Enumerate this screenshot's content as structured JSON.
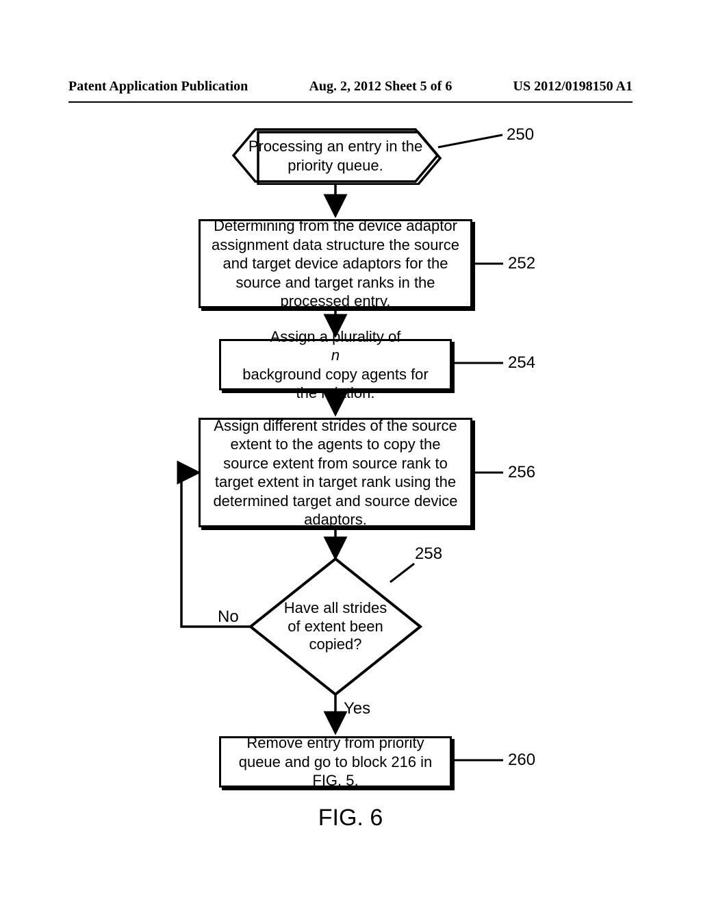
{
  "header": {
    "left": "Patent Application Publication",
    "mid": "Aug. 2, 2012  Sheet 5 of 6",
    "right": "US 2012/0198150 A1"
  },
  "fig": {
    "caption": "FIG. 6"
  },
  "nodes": {
    "n250": {
      "ref": "250",
      "text": "Processing an entry in the priority queue."
    },
    "n252": {
      "ref": "252",
      "text": "Determining from the device adaptor assignment data structure the source and target device adaptors for the source and target ranks in the processed entry."
    },
    "n254": {
      "ref": "254",
      "text_a": "Assign a plurality of ",
      "text_ital": "n",
      "text_b": " background copy agents for the relation."
    },
    "n256": {
      "ref": "256",
      "text": "Assign different strides of the source extent to the agents to copy the source extent from source rank to target extent in target rank using the determined target and source device adaptors."
    },
    "n258": {
      "ref": "258",
      "text": "Have all strides of extent been copied?",
      "yes": "Yes",
      "no": "No"
    },
    "n260": {
      "ref": "260",
      "text": "Remove entry from priority queue and go to block 216 in FIG. 5."
    }
  }
}
